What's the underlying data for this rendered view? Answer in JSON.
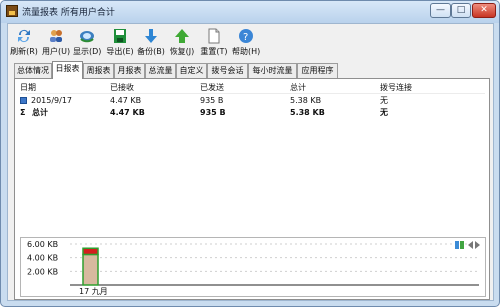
{
  "window": {
    "title": "流量报表 所有用户合计",
    "minimize_label": "—",
    "maximize_label": "□",
    "close_label": "✕"
  },
  "toolbar": {
    "items": [
      {
        "label": "刷新(R)",
        "icon": "refresh-icon"
      },
      {
        "label": "用户(U)",
        "icon": "users-icon"
      },
      {
        "label": "显示(D)",
        "icon": "display-icon"
      },
      {
        "label": "导出(E)",
        "icon": "export-icon"
      },
      {
        "label": "备份(B)",
        "icon": "backup-icon"
      },
      {
        "label": "恢复(J)",
        "icon": "restore-icon"
      },
      {
        "label": "重置(T)",
        "icon": "reset-icon"
      },
      {
        "label": "帮助(H)",
        "icon": "help-icon"
      }
    ]
  },
  "tabs": [
    {
      "label": "总体情况"
    },
    {
      "label": "日报表"
    },
    {
      "label": "周报表"
    },
    {
      "label": "月报表"
    },
    {
      "label": "总流量"
    },
    {
      "label": "自定义"
    },
    {
      "label": "拨号会话"
    },
    {
      "label": "每小时流量"
    },
    {
      "label": "应用程序"
    }
  ],
  "table": {
    "columns": [
      "日期",
      "已接收",
      "已发送",
      "总计",
      "拨号连接"
    ],
    "rows": [
      [
        "2015/9/17",
        "4.47 KB",
        "935 B",
        "5.38 KB",
        "无"
      ],
      [
        "总计",
        "4.47 KB",
        "935 B",
        "5.38 KB",
        "无"
      ]
    ],
    "total_marker": "Σ"
  },
  "chart_data": {
    "type": "bar",
    "categories": [
      "17 九月"
    ],
    "y_ticks": [
      "6.00 KB",
      "4.00 KB",
      "2.00 KB"
    ],
    "ylim": [
      0,
      6.0
    ],
    "series": [
      {
        "values": [
          5.38
        ],
        "stack_parts": [
          0.935,
          4.47
        ]
      }
    ],
    "grid": true
  },
  "colors": {
    "window_border": "#6f8bad",
    "titlebar_top": "#d8e8f8",
    "panel_background": "#ffffff",
    "bar_top": "#d41e1e",
    "bar_main": "#d7b99f",
    "bar_edge": "#2f9f2f",
    "grid": "#cfcfcf"
  }
}
